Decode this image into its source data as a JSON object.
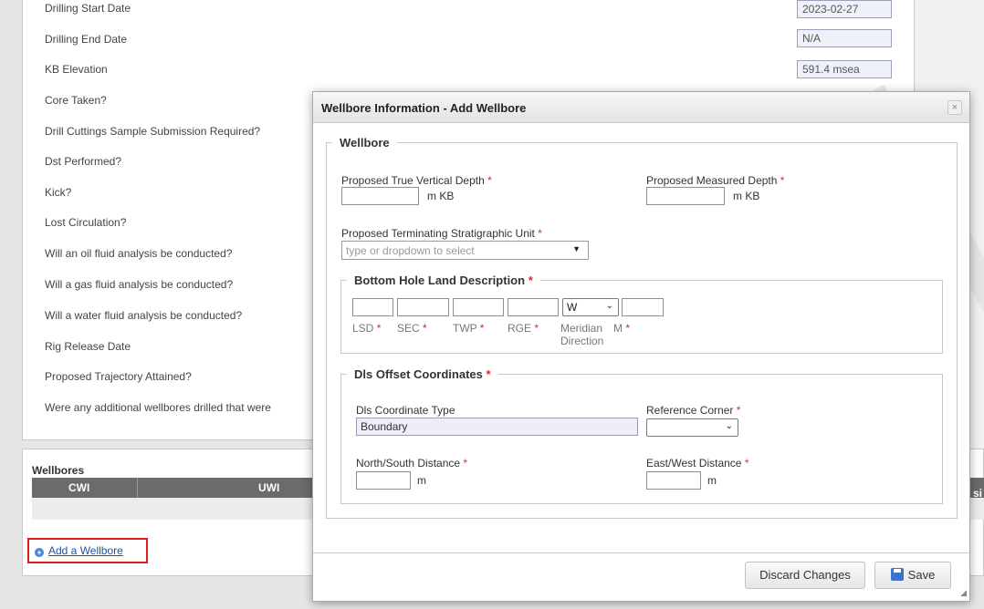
{
  "background": {
    "fields": [
      {
        "label": "Drilling Start Date",
        "value": "2023-02-27"
      },
      {
        "label": "Drilling End Date",
        "value": "N/A"
      },
      {
        "label": "KB Elevation",
        "value": "591.4 msea"
      },
      {
        "label": "Core Taken?"
      },
      {
        "label": "Drill Cuttings Sample Submission Required?"
      },
      {
        "label": "Dst Performed?"
      },
      {
        "label": "Kick?"
      },
      {
        "label": "Lost Circulation?"
      },
      {
        "label": "Will an oil fluid analysis be conducted?"
      },
      {
        "label": "Will a gas fluid analysis be conducted?"
      },
      {
        "label": "Will a water fluid analysis be conducted?"
      },
      {
        "label": "Rig Release Date"
      },
      {
        "label": "Proposed Trajectory Attained?"
      },
      {
        "label": "Were any additional wellbores drilled that were"
      }
    ],
    "wellbores": {
      "title": "Wellbores",
      "columns": [
        "CWI",
        "UWI"
      ],
      "overflow_text": "si",
      "add_link": "Add a Wellbore"
    }
  },
  "modal": {
    "title": "Wellbore Information - Add Wellbore",
    "close_glyph": "×",
    "wellbore_legend": "Wellbore",
    "tvd_label": "Proposed True Vertical Depth",
    "tvd_value": "",
    "tvd_unit": "m KB",
    "md_label": "Proposed Measured Depth",
    "md_value": "",
    "md_unit": "m KB",
    "strat_label": "Proposed Terminating Stratigraphic Unit",
    "strat_placeholder": "type or dropdown to select",
    "required_mark": "*",
    "bhl_legend": "Bottom Hole Land Description",
    "bhl_meridian_value": "W",
    "bhl_labels": {
      "lsd": "LSD",
      "sec": "SEC",
      "twp": "TWP",
      "rge": "RGE",
      "meridian_dir_line1": "Meridian",
      "meridian_dir_line2": "Direction",
      "m": "M"
    },
    "dls_legend": "Dls Offset Coordinates",
    "coord_type_label": "Dls Coordinate Type",
    "coord_type_value": "Boundary",
    "ref_corner_label": "Reference Corner",
    "ref_corner_value": "",
    "ns_label": "North/South Distance",
    "ns_value": "",
    "ns_unit": "m",
    "ew_label": "East/West Distance",
    "ew_value": "",
    "ew_unit": "m",
    "discard_label": "Discard Changes",
    "save_label": "Save"
  },
  "colors": {
    "required": "#e0262b",
    "link": "#1f4fa0",
    "highlight_border": "#e01b1b"
  }
}
